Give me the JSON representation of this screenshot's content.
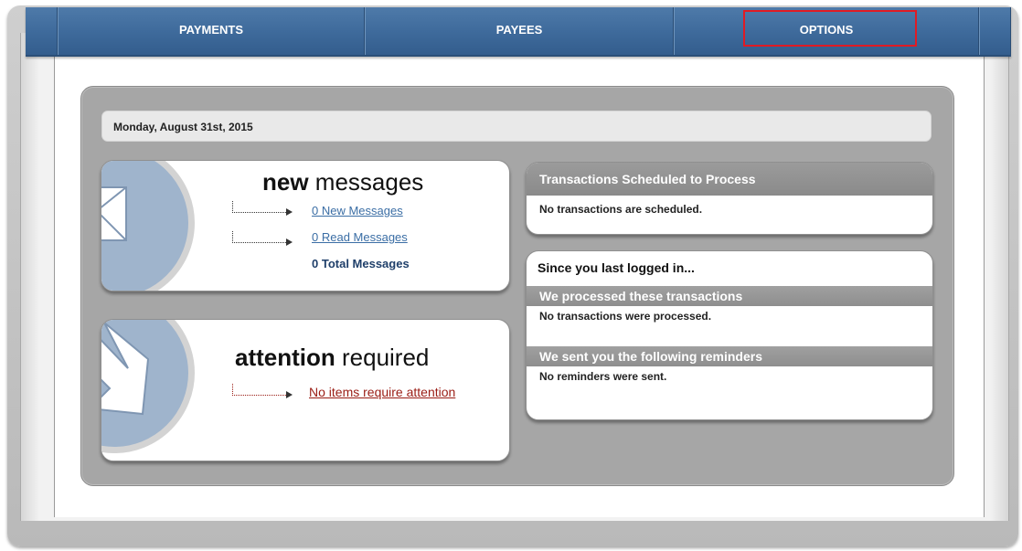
{
  "nav": {
    "tabs": [
      {
        "label": "PAYMENTS"
      },
      {
        "label": "PAYEES"
      },
      {
        "label": "OPTIONS",
        "highlighted": true
      }
    ]
  },
  "date_text": "Monday, August 31st, 2015",
  "messages_card": {
    "title_bold": "new",
    "title_rest": " messages",
    "new_messages": "0 New Messages",
    "read_messages": "0 Read Messages",
    "total_messages": "0 Total Messages",
    "icon": "envelope-icon"
  },
  "attention_card": {
    "title_bold": "attention",
    "title_rest": " required",
    "link": "No items require attention",
    "icon": "arrow-icon"
  },
  "scheduled_card": {
    "header": "Transactions Scheduled to Process",
    "text": "No transactions are scheduled."
  },
  "since_card": {
    "title": "Since you last logged in...",
    "processed_header": "We processed these transactions",
    "processed_text": "No transactions were processed.",
    "reminders_header": "We sent you the following reminders",
    "reminders_text": "No reminders were sent."
  },
  "colors": {
    "nav_blue": "#3f6b9c",
    "highlight_red": "#e01b24",
    "link_blue": "#3b6ea5",
    "attention_red": "#9a1c14",
    "panel_gray": "#a6a6a6"
  }
}
